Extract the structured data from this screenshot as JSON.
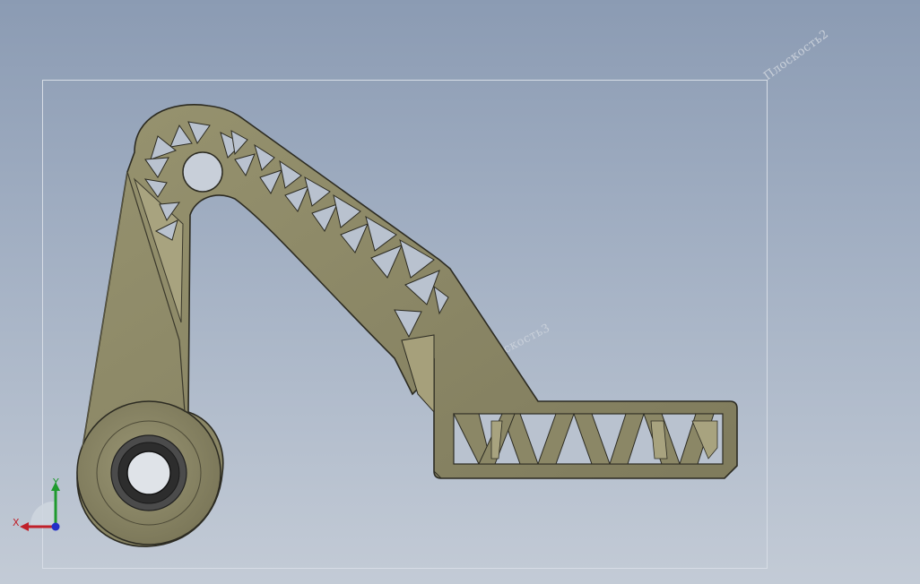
{
  "viewport": {
    "background_top": "#8b9bb3",
    "background_bottom": "#c3cbd6"
  },
  "reference_planes": {
    "plane_2_label": "Плоскость2",
    "plane_1_label": "Плоскость3"
  },
  "triad": {
    "x_label": "X",
    "y_label": "Y",
    "x_color": "#c0202a",
    "y_color": "#1f9a2e",
    "z_color": "#2330c8"
  },
  "part": {
    "body_color": "#8b8766",
    "edge_color": "#2c2b22",
    "bearing_color": "#4a4a4a"
  }
}
